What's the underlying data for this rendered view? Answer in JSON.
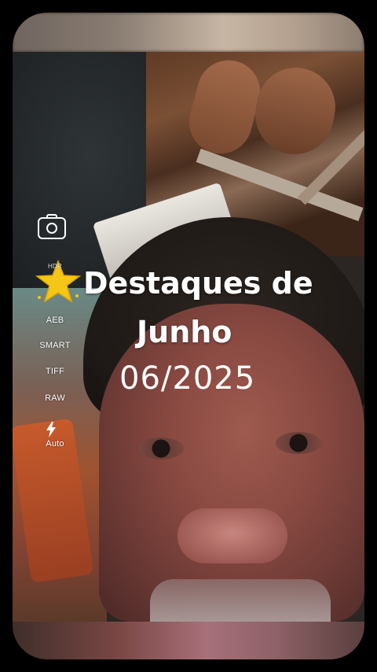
{
  "camera_options": {
    "hdr_label": "HDR",
    "aeb_label": "AEB",
    "smart_label": "SMART",
    "tiff_label": "TIFF",
    "raw_label": "RAW",
    "flash_label": "Auto"
  },
  "icons": {
    "camera_switch": "camera-rotate-icon",
    "star": "star-emoji-icon",
    "flash": "flash-bolt-icon"
  },
  "overlay": {
    "title_line1": "Destaques de",
    "title_line2": "Junho",
    "date": "06/2025"
  },
  "colors": {
    "background": "#000000",
    "text": "#ffffff",
    "star": "#f5c518"
  }
}
